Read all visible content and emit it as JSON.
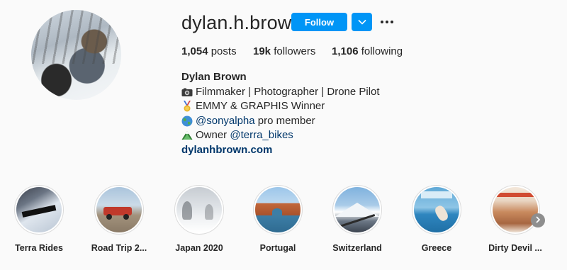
{
  "profile": {
    "username": "dylan.h.brown",
    "follow_label": "Follow",
    "stats": {
      "posts_count": "1,054",
      "posts_label": "posts",
      "followers_count": "19k",
      "followers_label": "followers",
      "following_count": "1,106",
      "following_label": "following"
    },
    "bio": {
      "full_name": "Dylan Brown",
      "line1": "Filmmaker | Photographer | Drone Pilot",
      "line2": "EMMY & GRAPHIS Winner",
      "line3_mention": "@sonyalpha",
      "line3_text": " pro member",
      "line4_text": "Owner ",
      "line4_mention": "@terra_bikes",
      "website": "dylanhbrown.com"
    }
  },
  "highlights": [
    {
      "label": "Terra Rides",
      "icon": "snow-bike-thumbnail"
    },
    {
      "label": "Road Trip 2...",
      "icon": "red-truck-thumbnail"
    },
    {
      "label": "Japan 2020",
      "icon": "foggy-snow-thumbnail"
    },
    {
      "label": "Portugal",
      "icon": "rock-arch-thumbnail"
    },
    {
      "label": "Switzerland",
      "icon": "mountain-thumbnail"
    },
    {
      "label": "Greece",
      "icon": "sea-dive-thumbnail"
    },
    {
      "label": "Dirty Devil ...",
      "icon": "canyon-thumbnail"
    }
  ],
  "colors": {
    "accent": "#0095f6",
    "link": "#00376b",
    "background": "#fafafa",
    "text": "#262626"
  },
  "icons": {
    "more": "more-horizontal-icon",
    "dropdown": "chevron-down-icon",
    "next": "chevron-right-icon",
    "line1_emoji": "camera-icon",
    "line2_emoji": "medal-icon",
    "line3_emoji": "globe-icon",
    "line4_emoji": "mountain-icon"
  }
}
